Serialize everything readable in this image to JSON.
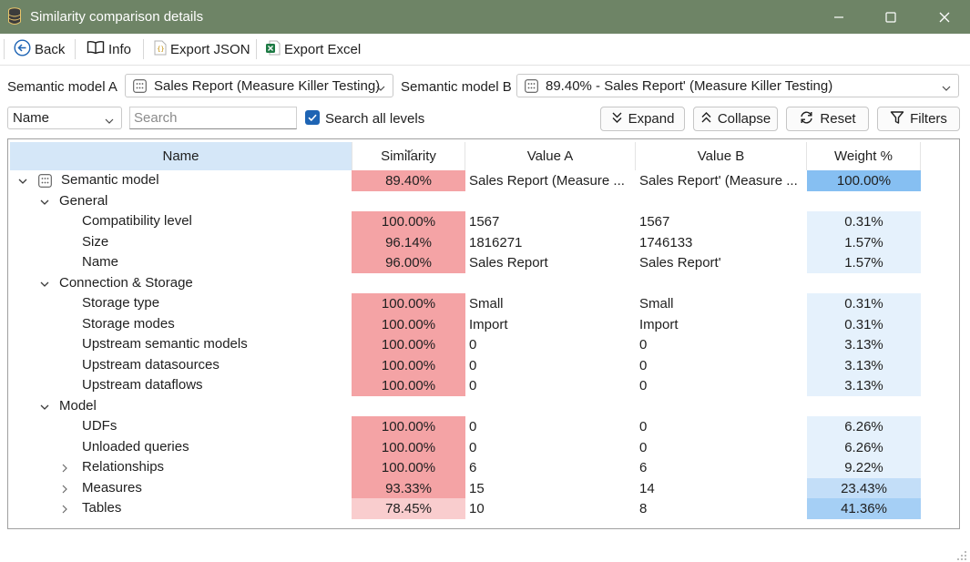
{
  "window": {
    "title": "Similarity comparison details"
  },
  "toolbar": {
    "back_label": "Back",
    "info_label": "Info",
    "export_json_label": "Export JSON",
    "export_excel_label": "Export Excel"
  },
  "models": {
    "label_a": "Semantic model A",
    "value_a": "Sales Report (Measure Killer Testing)",
    "label_b": "Semantic model B",
    "value_b": "89.40% - Sales Report' (Measure Killer Testing)"
  },
  "filters": {
    "field_select": "Name",
    "search_placeholder": "Search",
    "search_all_levels_label": "Search all levels",
    "search_all_levels_checked": true,
    "expand_label": "Expand",
    "collapse_label": "Collapse",
    "reset_label": "Reset",
    "filters_label": "Filters"
  },
  "grid": {
    "columns": {
      "name": "Name",
      "similarity": "Similarity",
      "value_a": "Value A",
      "value_b": "Value B",
      "weight": "Weight %"
    },
    "rows": [
      {
        "name": "Semantic model",
        "level": 0,
        "expander": "expanded",
        "icon": "model-icon",
        "similarity": "89.40%",
        "value_a": "Sales Report (Measure ...",
        "value_b": "Sales Report' (Measure ...",
        "weight": "100.00%",
        "sim_color": "#f4a3a5",
        "w_color": "#86bff2"
      },
      {
        "name": "General",
        "level": 1,
        "expander": "expanded",
        "similarity": "",
        "value_a": "",
        "value_b": "",
        "weight": ""
      },
      {
        "name": "Compatibility level",
        "level": 2,
        "similarity": "100.00%",
        "value_a": "1567",
        "value_b": "1567",
        "weight": "0.31%",
        "sim_color": "#f4a3a5",
        "w_color": "#e5f1fc"
      },
      {
        "name": "Size",
        "level": 2,
        "similarity": "96.14%",
        "value_a": "1816271",
        "value_b": "1746133",
        "weight": "1.57%",
        "sim_color": "#f4a3a5",
        "w_color": "#e5f1fc"
      },
      {
        "name": "Name",
        "level": 2,
        "similarity": "96.00%",
        "value_a": "Sales Report",
        "value_b": "Sales Report'",
        "weight": "1.57%",
        "sim_color": "#f4a3a5",
        "w_color": "#e5f1fc"
      },
      {
        "name": "Connection & Storage",
        "level": 1,
        "expander": "expanded",
        "similarity": "",
        "value_a": "",
        "value_b": "",
        "weight": ""
      },
      {
        "name": "Storage type",
        "level": 2,
        "similarity": "100.00%",
        "value_a": "Small",
        "value_b": "Small",
        "weight": "0.31%",
        "sim_color": "#f4a3a5",
        "w_color": "#e5f1fc"
      },
      {
        "name": "Storage modes",
        "level": 2,
        "similarity": "100.00%",
        "value_a": "Import",
        "value_b": "Import",
        "weight": "0.31%",
        "sim_color": "#f4a3a5",
        "w_color": "#e5f1fc"
      },
      {
        "name": "Upstream semantic models",
        "level": 2,
        "similarity": "100.00%",
        "value_a": "0",
        "value_b": "0",
        "weight": "3.13%",
        "sim_color": "#f4a3a5",
        "w_color": "#e5f1fc"
      },
      {
        "name": "Upstream datasources",
        "level": 2,
        "similarity": "100.00%",
        "value_a": "0",
        "value_b": "0",
        "weight": "3.13%",
        "sim_color": "#f4a3a5",
        "w_color": "#e5f1fc"
      },
      {
        "name": "Upstream dataflows",
        "level": 2,
        "similarity": "100.00%",
        "value_a": "0",
        "value_b": "0",
        "weight": "3.13%",
        "sim_color": "#f4a3a5",
        "w_color": "#e5f1fc"
      },
      {
        "name": "Model",
        "level": 1,
        "expander": "expanded",
        "similarity": "",
        "value_a": "",
        "value_b": "",
        "weight": ""
      },
      {
        "name": "UDFs",
        "level": 2,
        "similarity": "100.00%",
        "value_a": "0",
        "value_b": "0",
        "weight": "6.26%",
        "sim_color": "#f4a3a5",
        "w_color": "#e5f1fc"
      },
      {
        "name": "Unloaded queries",
        "level": 2,
        "similarity": "100.00%",
        "value_a": "0",
        "value_b": "0",
        "weight": "6.26%",
        "sim_color": "#f4a3a5",
        "w_color": "#e5f1fc"
      },
      {
        "name": "Relationships",
        "level": 2,
        "expander": "collapsed",
        "similarity": "100.00%",
        "value_a": "6",
        "value_b": "6",
        "weight": "9.22%",
        "sim_color": "#f4a3a5",
        "w_color": "#e5f1fc"
      },
      {
        "name": "Measures",
        "level": 2,
        "expander": "collapsed",
        "similarity": "93.33%",
        "value_a": "15",
        "value_b": "14",
        "weight": "23.43%",
        "sim_color": "#f4a3a5",
        "w_color": "#c3def8"
      },
      {
        "name": "Tables",
        "level": 2,
        "expander": "collapsed",
        "similarity": "78.45%",
        "value_a": "10",
        "value_b": "8",
        "weight": "41.36%",
        "sim_color": "#f9cdce",
        "w_color": "#a5cff5"
      }
    ]
  },
  "colors": {
    "titlebar": "#6e8466",
    "accent": "#1e64b4",
    "header_selected": "#d5e7f8"
  }
}
